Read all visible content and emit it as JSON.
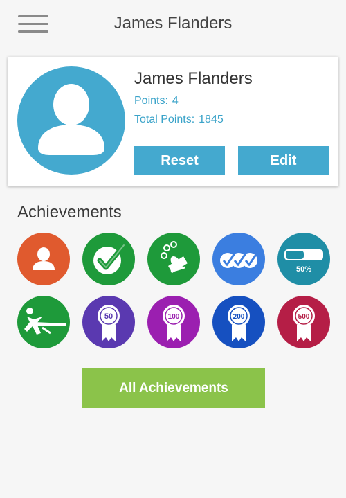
{
  "header": {
    "title": "James Flanders",
    "menu_icon": "hamburger-menu-icon"
  },
  "profile": {
    "name": "James Flanders",
    "points_label": "Points:",
    "points_value": "4",
    "total_label": "Total Points:",
    "total_value": "1845",
    "reset_label": "Reset",
    "edit_label": "Edit",
    "accent": "#44a9cf"
  },
  "achievements": {
    "title": "Achievements",
    "badges": [
      {
        "icon": "person-icon",
        "color": "#e05a2e"
      },
      {
        "icon": "checkmark-icon",
        "color": "#1e9a3a"
      },
      {
        "icon": "magic-hat-icon",
        "color": "#1e9a3a"
      },
      {
        "icon": "triple-check-icon",
        "color": "#3b7ee0"
      },
      {
        "icon": "progress-icon",
        "color": "#1f8ea6",
        "text": "50%",
        "progress": 0.5
      },
      {
        "icon": "finish-line-runner-icon",
        "color": "#1e9a3a"
      },
      {
        "icon": "ribbon-50-icon",
        "color": "#5a39b0",
        "text": "50"
      },
      {
        "icon": "ribbon-100-icon",
        "color": "#9b1fb0",
        "text": "100"
      },
      {
        "icon": "ribbon-200-icon",
        "color": "#1650c0",
        "text": "200"
      },
      {
        "icon": "ribbon-500-icon",
        "color": "#b51e46",
        "text": "500"
      }
    ],
    "all_label": "All Achievements",
    "all_color": "#8bc34a"
  }
}
